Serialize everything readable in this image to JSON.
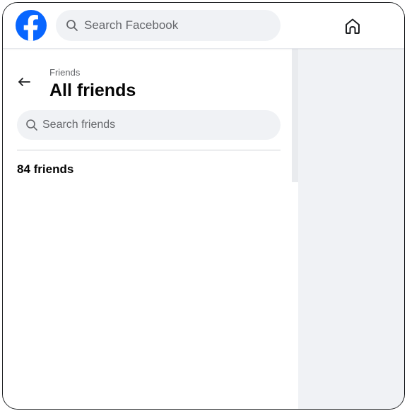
{
  "header": {
    "logo_icon": "facebook-logo-icon",
    "search_placeholder": "Search Facebook",
    "search_icon": "search-icon",
    "home_icon": "home-icon"
  },
  "friends_panel": {
    "breadcrumb": "Friends",
    "title": "All friends",
    "back_icon": "back-arrow-icon",
    "search_placeholder": "Search friends",
    "friend_count": "84 friends"
  },
  "colors": {
    "brand": "#0866ff",
    "search_bg": "#f0f2f5",
    "content_bg": "#f0f2f5",
    "primary_text": "#050505",
    "secondary_text": "#65676b"
  }
}
